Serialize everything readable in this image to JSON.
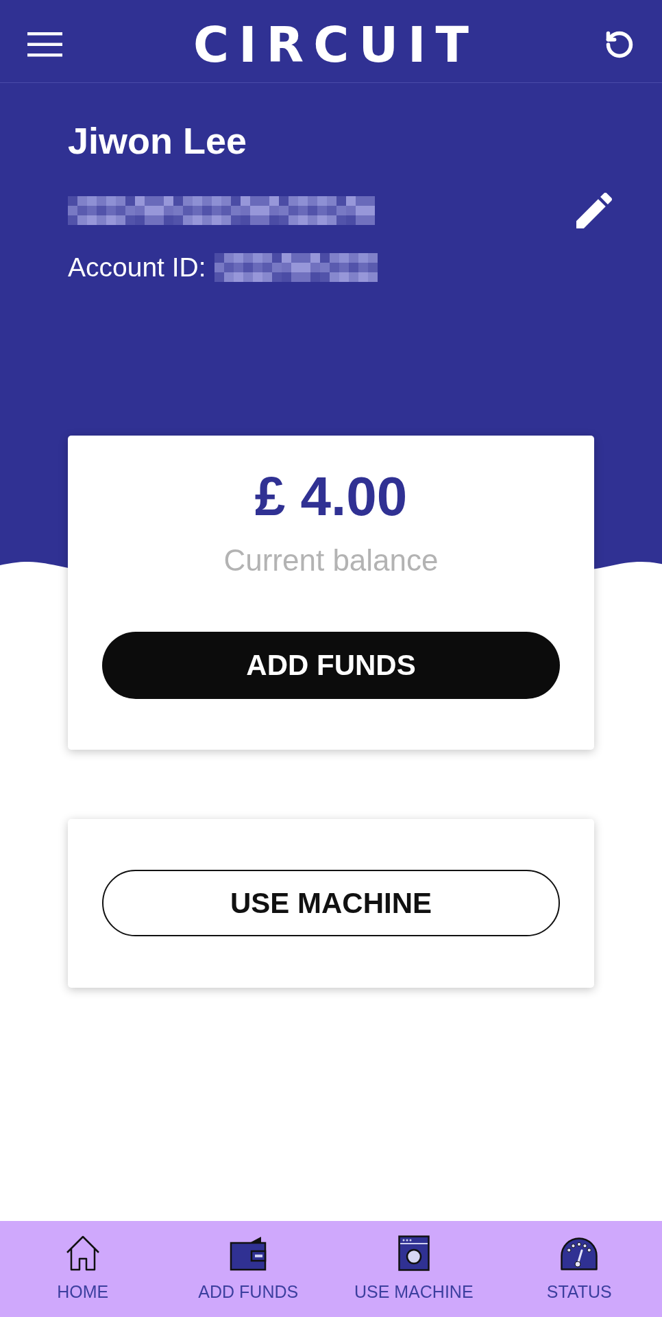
{
  "app_bar": {
    "logo": "CIRCUIT"
  },
  "profile": {
    "name": "Jiwon Lee",
    "account_id_label": "Account ID:"
  },
  "balance_card": {
    "amount": "£ 4.00",
    "caption": "Current balance",
    "button": "ADD FUNDS"
  },
  "machine_card": {
    "button": "USE MACHINE"
  },
  "bottom_nav": [
    {
      "label": "HOME"
    },
    {
      "label": "ADD FUNDS"
    },
    {
      "label": "USE MACHINE"
    },
    {
      "label": "STATUS"
    }
  ]
}
